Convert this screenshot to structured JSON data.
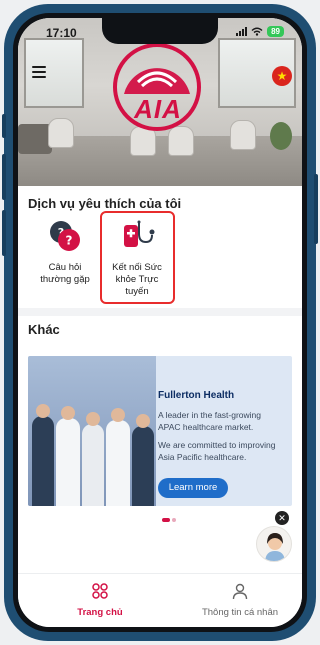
{
  "status_bar": {
    "time": "17:10",
    "battery": "89"
  },
  "header": {
    "brand": "AIA",
    "language_flag": "★"
  },
  "favorites": {
    "title": "Dịch vụ yêu thích của tôi",
    "items": [
      {
        "label_line1": "Câu hỏi",
        "label_line2": "thường gặp"
      },
      {
        "label_line1": "Kết nối Sức",
        "label_line2": "khỏe Trực",
        "label_line3": "tuyến"
      }
    ]
  },
  "other": {
    "title": "Khác",
    "promo": {
      "brand": "Fullerton Health",
      "line1": "A leader in the fast-growing",
      "line2": "APAC healthcare market.",
      "line3": "We are committed to improving",
      "line4": "Asia Pacific healthcare.",
      "cta": "Learn more"
    }
  },
  "chat": {
    "close": "✕"
  },
  "bottom_nav": {
    "home": "Trang chủ",
    "profile": "Thông tin cá nhân"
  },
  "colors": {
    "brand_red": "#d31145",
    "highlight": "#e82c2c",
    "cta_blue": "#1f6dc9",
    "frame": "#1f4e72"
  }
}
